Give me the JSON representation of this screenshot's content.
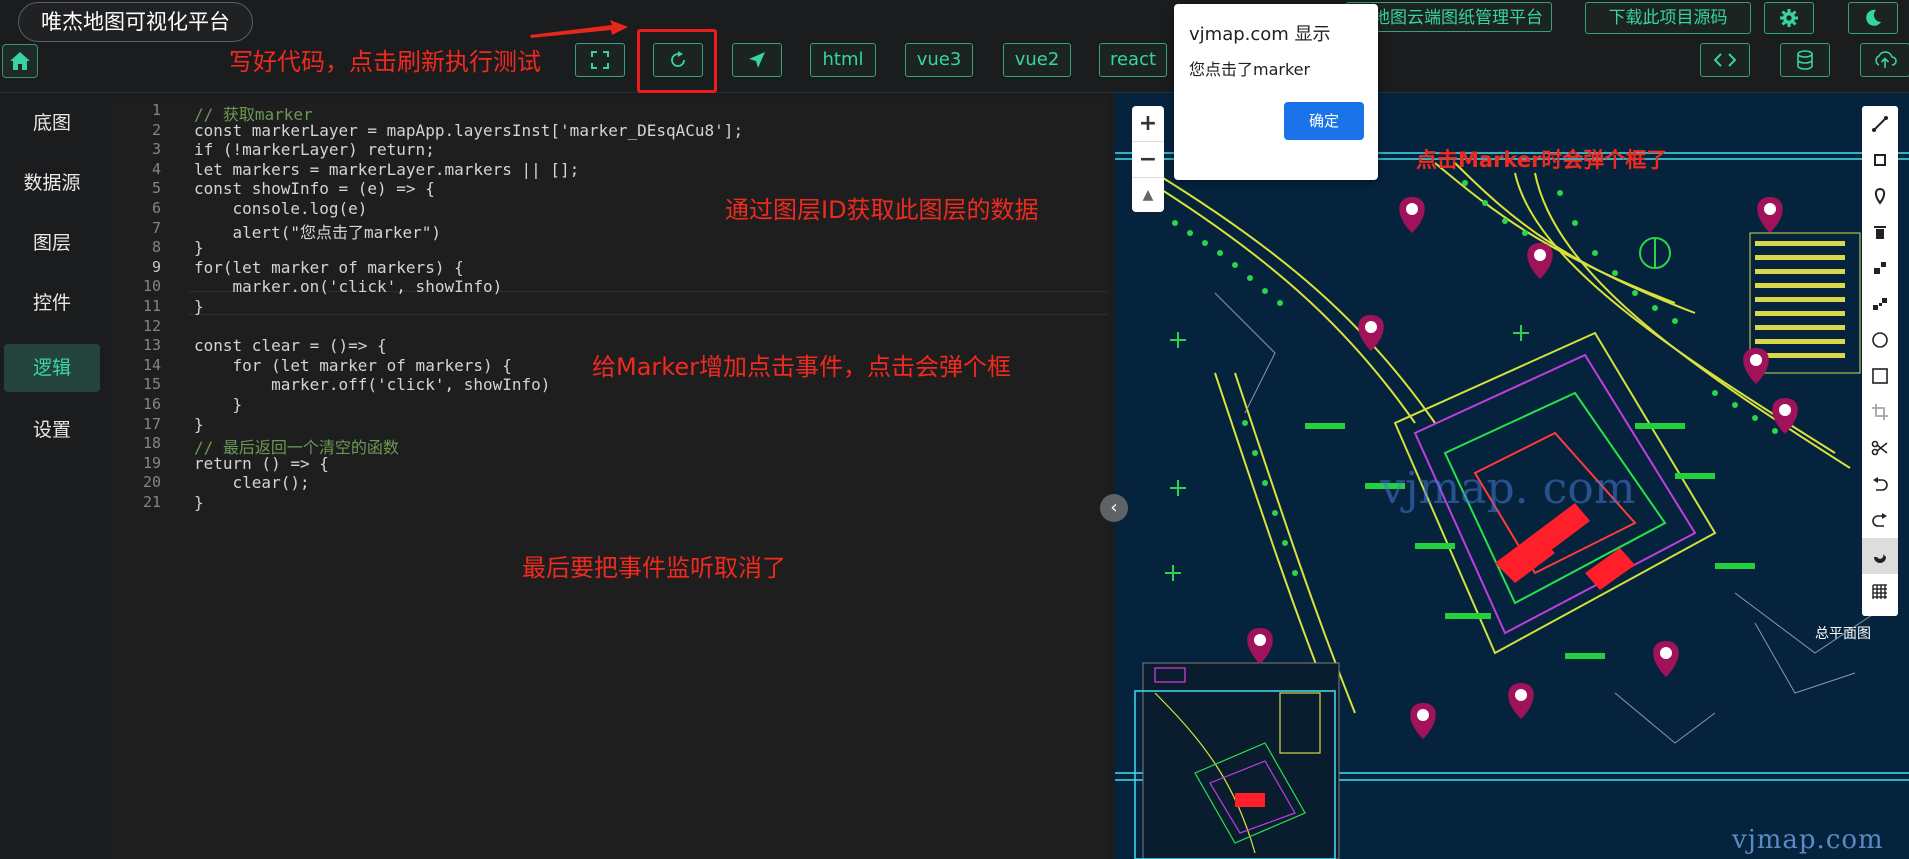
{
  "header": {
    "app_title": "唯杰地图可视化平台",
    "buttons": [
      "html",
      "vue3",
      "vue2",
      "react"
    ],
    "top_right_buttons": [
      "地图云端图纸管理平台",
      "下载此项目源码"
    ],
    "icons": [
      "fullscreen-icon",
      "refresh-icon",
      "locate-icon",
      "code-icon",
      "database-icon",
      "cloud-upload-icon",
      "gear-icon",
      "moon-icon",
      "home-icon"
    ]
  },
  "sidebar": {
    "items": [
      {
        "label": "底图",
        "active": false
      },
      {
        "label": "数据源",
        "active": false
      },
      {
        "label": "图层",
        "active": false
      },
      {
        "label": "控件",
        "active": false
      },
      {
        "label": "逻辑",
        "active": true
      },
      {
        "label": "设置",
        "active": false
      }
    ]
  },
  "editor": {
    "lines": [
      "// 获取marker",
      "const markerLayer = mapApp.layersInst['marker_DEsqACu8'];",
      "if (!markerLayer) return;",
      "let markers = markerLayer.markers || [];",
      "const showInfo = (e) => {",
      "    console.log(e)",
      "    alert(\"您点击了marker\")",
      "}",
      "for(let marker of markers) {",
      "    marker.on('click', showInfo)",
      "}",
      "",
      "const clear = ()=> {",
      "    for (let marker of markers) {",
      "        marker.off('click', showInfo)",
      "    }",
      "}",
      "// 最后返回一个清空的函数",
      "return () => {",
      "    clear();",
      "}"
    ],
    "line_numbers": [
      "1",
      "2",
      "3",
      "4",
      "5",
      "6",
      "7",
      "8",
      "9",
      "10",
      "11",
      "12",
      "13",
      "14",
      "15",
      "16",
      "17",
      "18",
      "19",
      "20",
      "21"
    ],
    "current_line": 9
  },
  "annotations": {
    "refresh_note": "写好代码，点击刷新执行测试",
    "layer_note": "通过图层ID获取此图层的数据",
    "event_note": "给Marker增加点击事件，点击会弹个框",
    "cancel_note": "最后要把事件监听取消了",
    "popup_note": "点击Marker时会弹个框了"
  },
  "dialog": {
    "title": "vjmap.com 显示",
    "message": "您点击了marker",
    "ok_label": "确定"
  },
  "map": {
    "zoom_in": "+",
    "zoom_out": "−",
    "compass": "▲",
    "collapse": "‹",
    "watermark": "vjmap.com",
    "center_watermark": "vjmap. com"
  },
  "colors": {
    "accent": "#37d3a4",
    "annotation": "#f02a1e",
    "map_bg": "#06233d",
    "marker": "#a0135b"
  }
}
